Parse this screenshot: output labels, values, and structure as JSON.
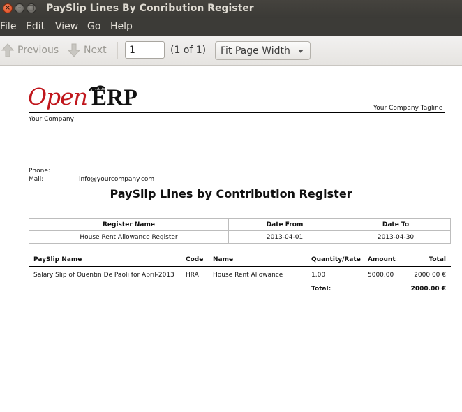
{
  "window": {
    "title": "PaySlip Lines By Conribution Register"
  },
  "menu": [
    "File",
    "Edit",
    "View",
    "Go",
    "Help"
  ],
  "toolbar": {
    "previous_label": "Previous",
    "next_label": "Next",
    "page_value": "1",
    "page_count": "(1 of 1)",
    "zoom_label": "Fit Page Width"
  },
  "report": {
    "logo_open": "Open",
    "logo_erp": "ERP",
    "tagline": "Your Company Tagline",
    "company": "Your Company",
    "phone_label": "Phone:",
    "mail_label": "Mail:",
    "mail_value": "info@yourcompany.com",
    "title": "PaySlip Lines by Contribution Register",
    "register_headers": [
      "Register Name",
      "Date From",
      "Date To"
    ],
    "register_values": [
      "House Rent Allowance Register",
      "2013-04-01",
      "2013-04-30"
    ],
    "line_headers": [
      "PaySlip Name",
      "Code",
      "Name",
      "Quantity/Rate",
      "Amount",
      "Total"
    ],
    "lines": [
      [
        "Salary Slip of Quentin De Paoli for April-2013",
        "HRA",
        "House Rent Allowance",
        "1.00",
        "5000.00",
        "2000.00 €"
      ]
    ],
    "total_label": "Total:",
    "total_value": "2000.00 €"
  }
}
